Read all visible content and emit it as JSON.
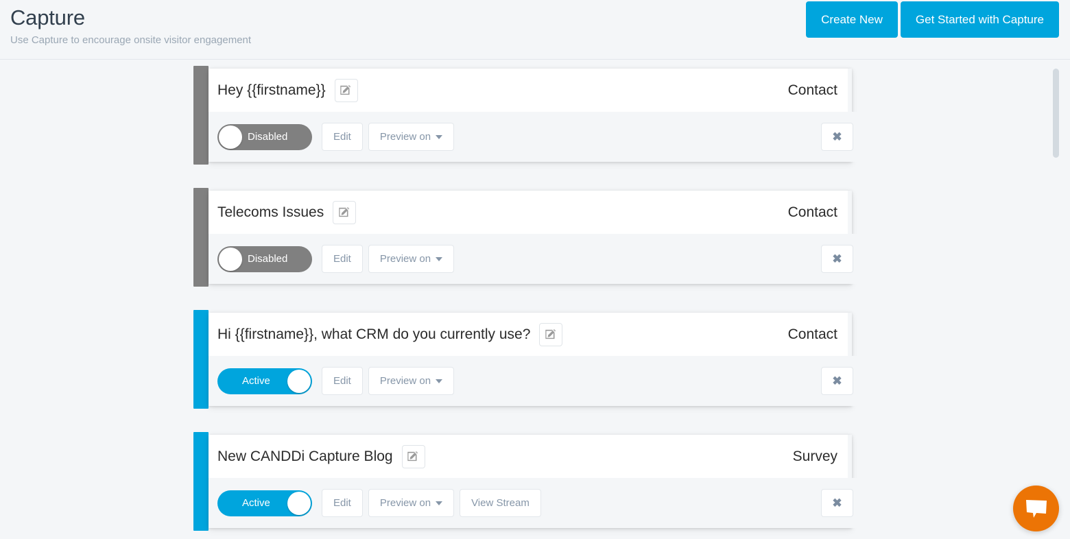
{
  "header": {
    "title": "Capture",
    "subtitle": "Use Capture to encourage onsite visitor engagement",
    "create_new_label": "Create New",
    "get_started_label": "Get Started with Capture",
    "accent_color": "#00a5dd"
  },
  "labels": {
    "edit_label": "Edit",
    "preview_label": "Preview on",
    "view_stream_label": "View Stream",
    "delete_glyph": "✖",
    "toggle_on_label": "Active",
    "toggle_off_label": "Disabled"
  },
  "colors": {
    "active_accent": "#00a5dd",
    "disabled_accent": "#808080",
    "chat_launcher": "#ec7405",
    "page_background": "#f4f6f8"
  },
  "cards": [
    {
      "title": "Hey {{firstname}}",
      "type": "Contact",
      "state": "disabled",
      "toggle_label": "Disabled",
      "edit_label": "Edit",
      "preview_label": "Preview on",
      "has_view_stream": false,
      "view_stream_label": ""
    },
    {
      "title": "Telecoms Issues",
      "type": "Contact",
      "state": "disabled",
      "toggle_label": "Disabled",
      "edit_label": "Edit",
      "preview_label": "Preview on",
      "has_view_stream": false,
      "view_stream_label": ""
    },
    {
      "title": "Hi {{firstname}}, what CRM do you currently use?",
      "type": "Contact",
      "state": "active",
      "toggle_label": "Active",
      "edit_label": "Edit",
      "preview_label": "Preview on",
      "has_view_stream": false,
      "view_stream_label": ""
    },
    {
      "title": "New CANDDi Capture Blog",
      "type": "Survey",
      "state": "active",
      "toggle_label": "Active",
      "edit_label": "Edit",
      "preview_label": "Preview on",
      "has_view_stream": true,
      "view_stream_label": "View Stream"
    }
  ],
  "chat": {
    "icon": "chat-bubble-icon"
  },
  "scrollbar": {
    "thumb_position": "top"
  }
}
